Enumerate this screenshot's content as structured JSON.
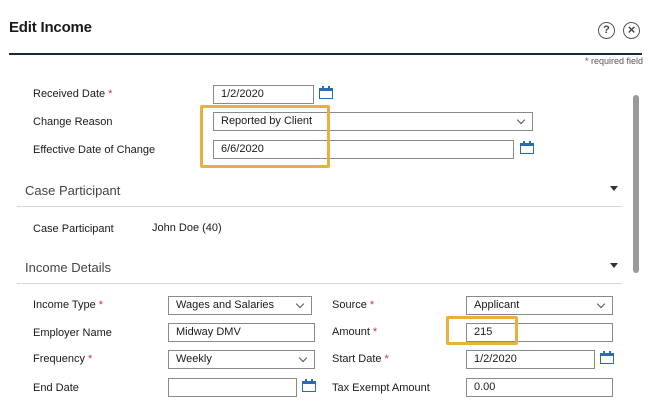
{
  "dialog": {
    "title": "Edit Income",
    "help_symbol": "?",
    "close_symbol": "×",
    "required_note": "* required field"
  },
  "top": {
    "received_date_label": "Received Date",
    "received_date_value": "1/2/2020",
    "change_reason_label": "Change Reason",
    "change_reason_value": "Reported by Client",
    "effective_date_label": "Effective Date of Change",
    "effective_date_value": "6/6/2020"
  },
  "case_participant": {
    "section_title": "Case Participant",
    "label": "Case Participant",
    "value": "John Doe (40)"
  },
  "income_details": {
    "section_title": "Income Details",
    "income_type_label": "Income Type",
    "income_type_value": "Wages and Salaries",
    "source_label": "Source",
    "source_value": "Applicant",
    "employer_label": "Employer Name",
    "employer_value": "Midway DMV",
    "amount_label": "Amount",
    "amount_value": "215",
    "frequency_label": "Frequency",
    "frequency_value": "Weekly",
    "start_date_label": "Start Date",
    "start_date_value": "1/2/2020",
    "end_date_label": "End Date",
    "end_date_value": "",
    "tax_exempt_label": "Tax Exempt Amount",
    "tax_exempt_value": "0.00"
  },
  "colors": {
    "highlight": "#e8b03c",
    "required_star": "#c0392b",
    "calendar_icon": "#2a6bb3"
  }
}
